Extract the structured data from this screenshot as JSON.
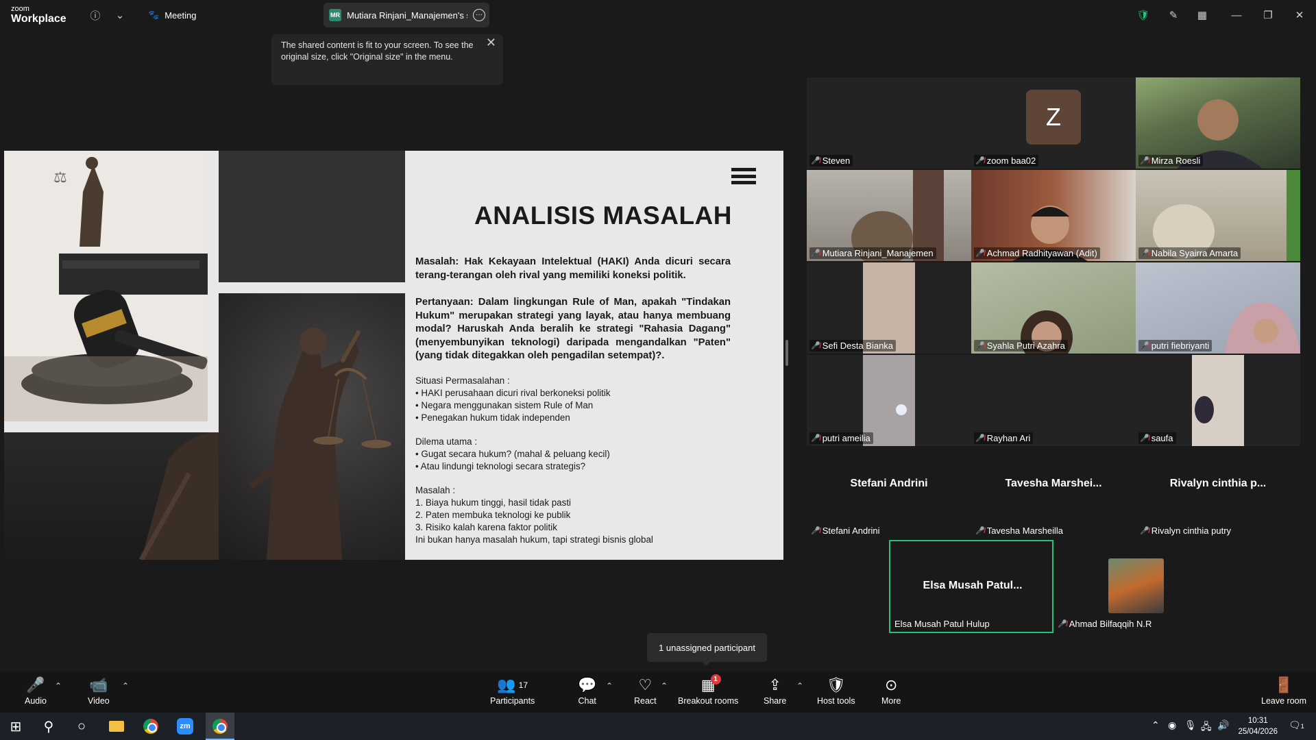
{
  "titlebar": {
    "logo_top": "zoom",
    "logo_bottom": "Workplace",
    "meeting_tab": "Meeting",
    "share_badge": "MR",
    "share_tab": "Mutiara Rinjani_Manajemen's screen"
  },
  "tooltip": {
    "text": "The shared content is fit to your screen. To see the original size, click \"Original size\" in the menu."
  },
  "slide": {
    "title": "ANALISIS MASALAH",
    "p1": "Masalah: Hak Kekayaan Intelektual (HAKI) Anda dicuri secara terang-terangan oleh rival yang memiliki koneksi politik.",
    "p2": "Pertanyaan: Dalam lingkungan Rule of Man, apakah \"Tindakan Hukum\" merupakan strategi yang layak, atau hanya membuang modal? Haruskah Anda beralih ke strategi \"Rahasia Dagang\" (menyembunyikan teknologi) daripada mengandalkan \"Paten\" (yang tidak ditegakkan oleh pengadilan setempat)?.",
    "situasi_head": "Situasi Permasalahan :",
    "situasi": [
      "• HAKI perusahaan dicuri rival berkoneksi politik",
      "• Negara menggunakan sistem Rule of Man",
      "• Penegakan hukum tidak independen"
    ],
    "dilema_head": "Dilema utama :",
    "dilema": [
      "• Gugat secara hukum? (mahal & peluang kecil)",
      "• Atau lindungi teknologi secara strategis?"
    ],
    "masalah_head": "Masalah :",
    "masalah": [
      "1. Biaya hukum tinggi, hasil tidak pasti",
      "2. Paten membuka teknologi ke publik",
      "3. Risiko kalah karena faktor politik",
      "Ini bukan hanya masalah hukum, tapi strategi bisnis global"
    ]
  },
  "participants": {
    "steven": "Steven",
    "zoom_initial": "Z",
    "zoom": "zoom baa02",
    "mirza": "Mirza Roesli",
    "mutiara": "Mutiara Rinjani_Manajemen",
    "achmad": "Achmad Radhityawan (Adit)",
    "nabila": "Nabila Syairra Amarta",
    "sefi": "Sefi Desta Bianka",
    "syahla": "Syahla Putri Azahra",
    "putri_f": "putri fiebriyanti",
    "putri_a": "putri ameilia",
    "rayhan": "Rayhan Ari",
    "saufa": "saufa",
    "stefani_big": "Stefani Andrini",
    "stefani": "Stefani Andrini",
    "tavesha_big": "Tavesha Marshei...",
    "tavesha": "Tavesha Marsheilla",
    "rivalyn_big": "Rivalyn cinthia p...",
    "rivalyn": "Rivalyn cinthia putry",
    "elsa_big": "Elsa Musah Patul...",
    "elsa": "Elsa Musah Patul Hulup",
    "ahmad": "Ahmad Bilfaqqih N.R"
  },
  "unassigned": "1 unassigned participant",
  "toolbar": {
    "audio": "Audio",
    "video": "Video",
    "participants": "Participants",
    "participants_count": "17",
    "chat": "Chat",
    "react": "React",
    "breakout": "Breakout rooms",
    "breakout_badge": "1",
    "share": "Share",
    "host_tools": "Host tools",
    "more": "More",
    "leave": "Leave room"
  },
  "taskbar": {
    "time": "10:31",
    "date": "25/04/2026",
    "zoom_label": "zm",
    "notif_count": "1"
  },
  "colors": {
    "accent_green": "#25c27a",
    "mic_off_red": "#e0383e"
  }
}
